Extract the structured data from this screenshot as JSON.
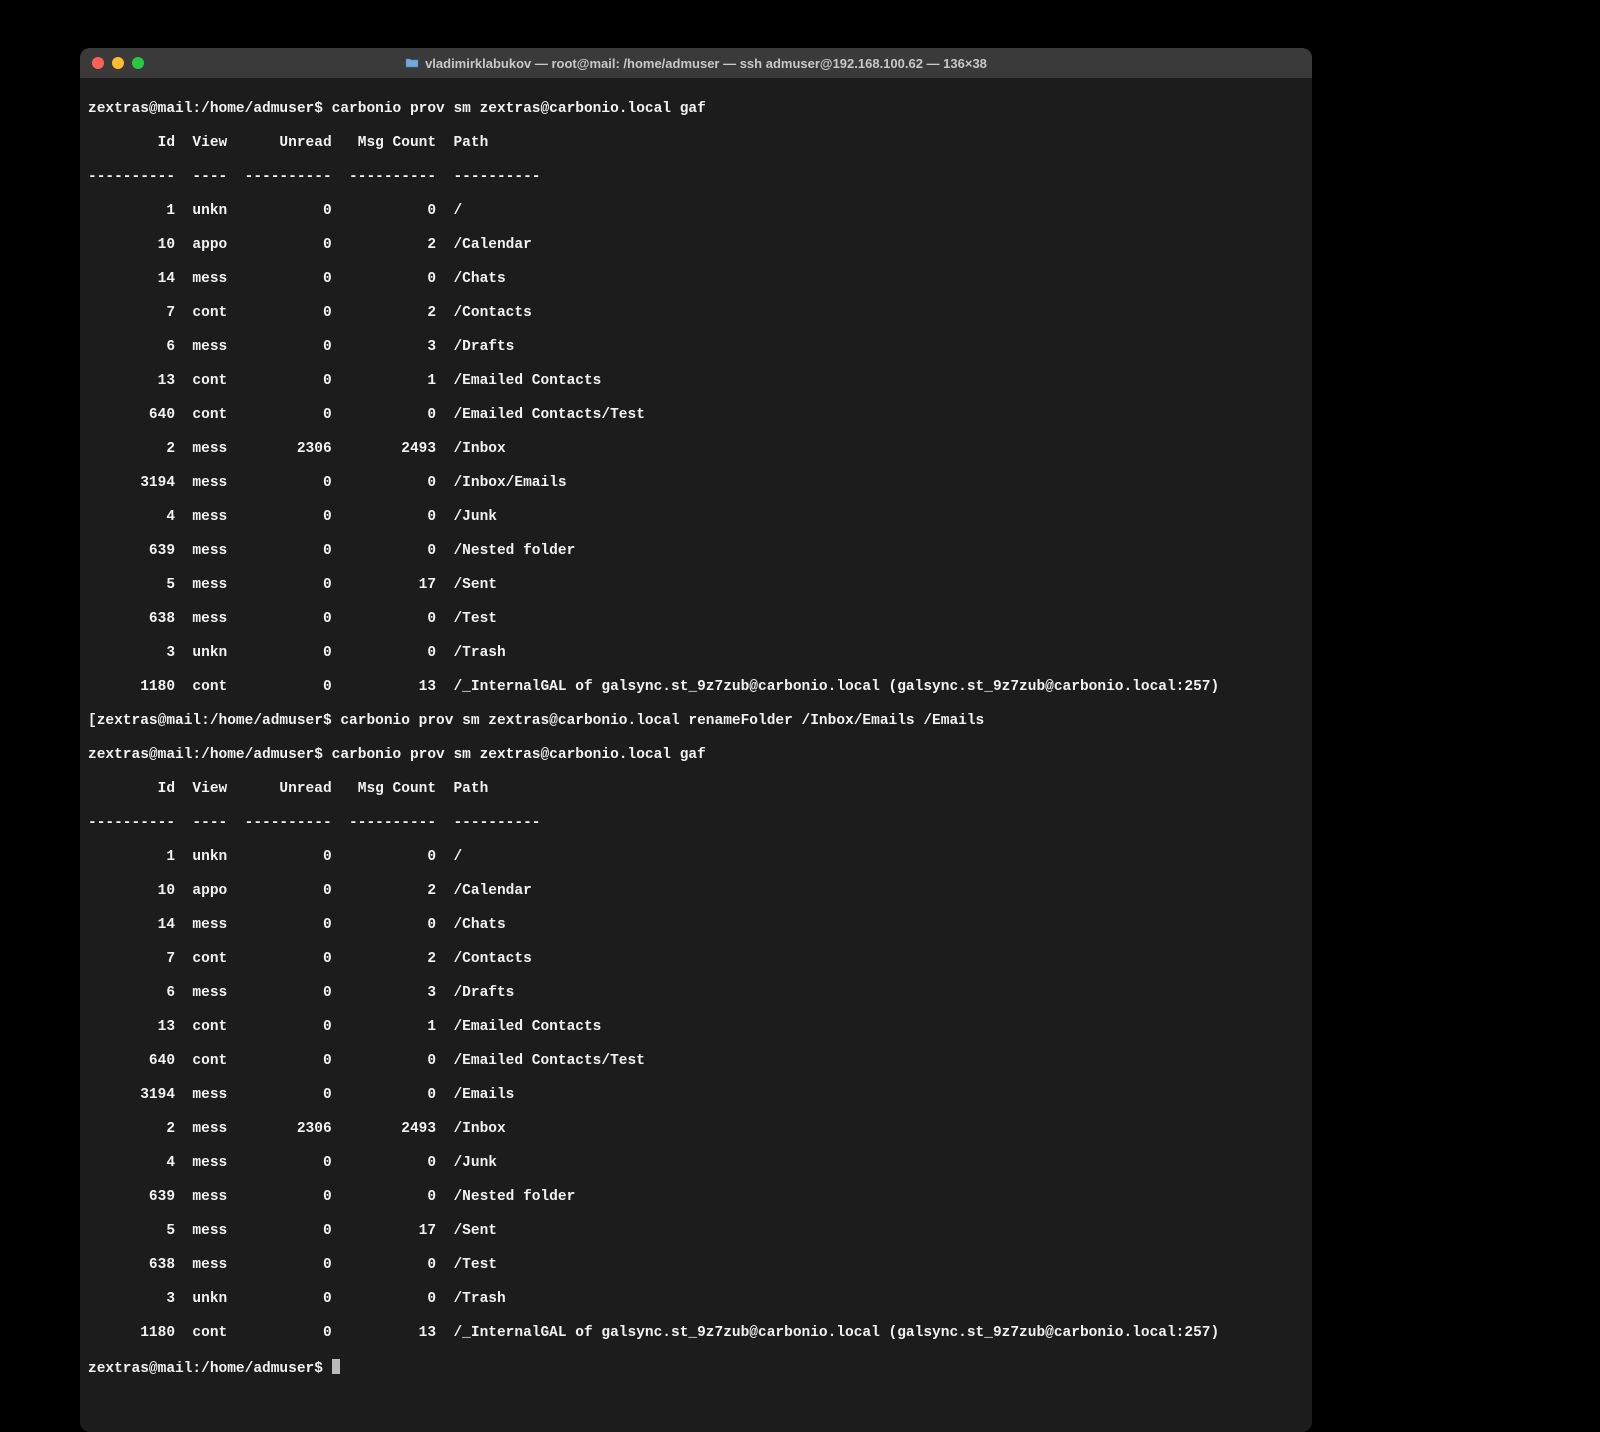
{
  "window": {
    "title": "vladimirklabukov — root@mail: /home/admuser — ssh admuser@192.168.100.62 — 136×38"
  },
  "prompt": "zextras@mail:/home/admuser$ ",
  "prompt_bracket": "[zextras@mail:/home/admuser$ ",
  "commands": {
    "c1": "carbonio prov sm zextras@carbonio.local gaf",
    "c2": "carbonio prov sm zextras@carbonio.local renameFolder /Inbox/Emails /Emails",
    "c3": "carbonio prov sm zextras@carbonio.local gaf"
  },
  "header": "        Id  View      Unread   Msg Count  Path",
  "divider": "----------  ----  ----------  ----------  ----------",
  "table1": [
    "         1  unkn           0           0  /",
    "        10  appo           0           2  /Calendar",
    "        14  mess           0           0  /Chats",
    "         7  cont           0           2  /Contacts",
    "         6  mess           0           3  /Drafts",
    "        13  cont           0           1  /Emailed Contacts",
    "       640  cont           0           0  /Emailed Contacts/Test",
    "         2  mess        2306        2493  /Inbox",
    "      3194  mess           0           0  /Inbox/Emails",
    "         4  mess           0           0  /Junk",
    "       639  mess           0           0  /Nested folder",
    "         5  mess           0          17  /Sent",
    "       638  mess           0           0  /Test",
    "         3  unkn           0           0  /Trash",
    "      1180  cont           0          13  /_InternalGAL of galsync.st_9z7zub@carbonio.local (galsync.st_9z7zub@carbonio.local:257)"
  ],
  "table2": [
    "         1  unkn           0           0  /",
    "        10  appo           0           2  /Calendar",
    "        14  mess           0           0  /Chats",
    "         7  cont           0           2  /Contacts",
    "         6  mess           0           3  /Drafts",
    "        13  cont           0           1  /Emailed Contacts",
    "       640  cont           0           0  /Emailed Contacts/Test",
    "      3194  mess           0           0  /Emails",
    "         2  mess        2306        2493  /Inbox",
    "         4  mess           0           0  /Junk",
    "       639  mess           0           0  /Nested folder",
    "         5  mess           0          17  /Sent",
    "       638  mess           0           0  /Test",
    "         3  unkn           0           0  /Trash",
    "      1180  cont           0          13  /_InternalGAL of galsync.st_9z7zub@carbonio.local (galsync.st_9z7zub@carbonio.local:257)"
  ]
}
